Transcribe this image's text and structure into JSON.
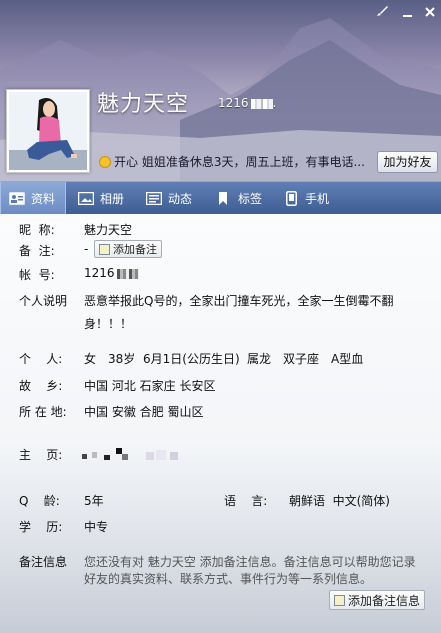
{
  "header": {
    "nickname": "魅力天空",
    "qq_number": "1216",
    "mood_text": "开心 姐姐准备休息3天，周五上班，有事电话...",
    "add_friend_label": "加为好友"
  },
  "tabs": [
    {
      "label": "资料",
      "icon": "profile-card-icon",
      "active": true
    },
    {
      "label": "相册",
      "icon": "photo-album-icon",
      "active": false
    },
    {
      "label": "动态",
      "icon": "feed-icon",
      "active": false
    },
    {
      "label": "标签",
      "icon": "bookmark-icon",
      "active": false
    },
    {
      "label": "手机",
      "icon": "mobile-phone-icon",
      "active": false
    }
  ],
  "profile": {
    "nickname_label": "昵  称:",
    "nickname_value": "魅力天空",
    "remark_label": "备  注:",
    "remark_value": "-",
    "add_remark_label": "添加备注",
    "account_label": "帐  号:",
    "account_value": "1216",
    "bio_label": "个人说明",
    "bio_line1": "恶意举报此Q号的，全家出门撞车死光，全家一生倒霉不翻",
    "bio_line2": "身！！！",
    "personal_label": "个    人:",
    "personal": {
      "gender": "女",
      "age": "38岁",
      "birthday": "6月1日(公历生日)",
      "zodiac": "属龙",
      "constellation": "双子座",
      "blood": "A型血"
    },
    "hometown_label": "故    乡:",
    "hometown": "中国 河北 石家庄 长安区",
    "location_label": "所 在 地:",
    "location": "中国 安徽 合肥 蜀山区",
    "homepage_label": "主    页:",
    "qage_label": "Q    龄:",
    "qage": "5年",
    "language_label": "语    言:",
    "languages": "朝鲜语  中文(简体)",
    "education_label": "学    历:",
    "education": "中专",
    "note_info_label": "备注信息",
    "note_info_line1": "您还没有对 魅力天空 添加备注信息。备注信息可以帮助您记录",
    "note_info_line2": "好友的真实资料、联系方式、事件行为等一系列信息。",
    "add_note_info_label": "添加备注信息"
  }
}
